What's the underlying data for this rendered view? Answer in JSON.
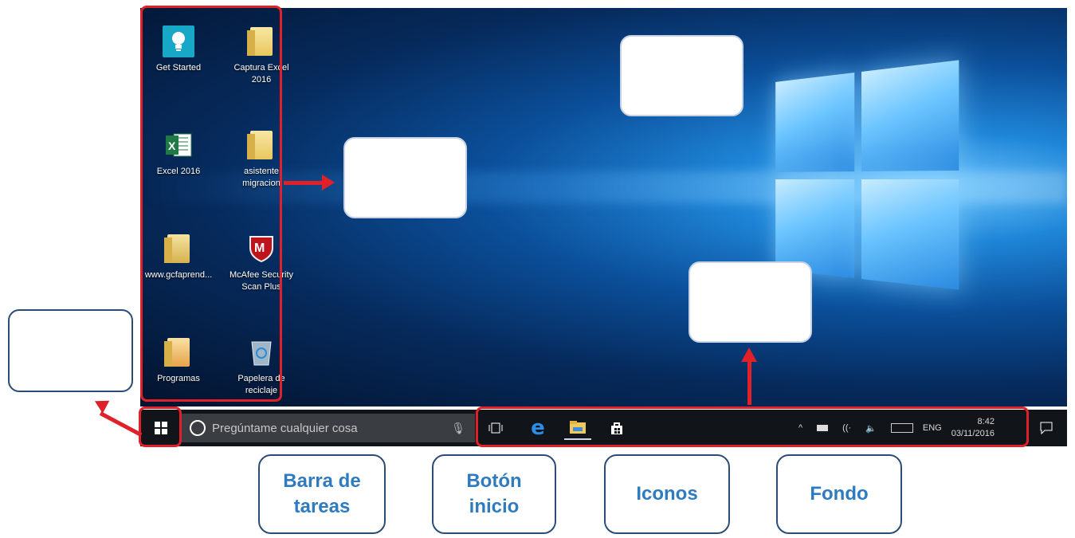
{
  "desktop": {
    "icons": [
      {
        "label": "Get Started",
        "icon": "get-started-icon"
      },
      {
        "label": "Captura Excel\n2016",
        "icon": "folder-icon"
      },
      {
        "label": "Excel 2016",
        "icon": "excel-icon"
      },
      {
        "label": "asistente\nmigracion",
        "icon": "folder-icon"
      },
      {
        "label": "www.gcfaprend...",
        "icon": "folder-icon"
      },
      {
        "label": "McAfee Security\nScan Plus",
        "icon": "mcafee-icon"
      },
      {
        "label": "Programas",
        "icon": "folder-icon"
      },
      {
        "label": "Papelera de\nreciclaje",
        "icon": "recycle-bin-icon"
      }
    ]
  },
  "taskbar": {
    "search_placeholder": "Pregúntame cualquier cosa",
    "tray": {
      "language": "ENG",
      "time": "8:42",
      "date": "03/11/2016"
    }
  },
  "cards": [
    {
      "text": "Barra de\ntareas"
    },
    {
      "text": "Botón\ninicio"
    },
    {
      "text": "Iconos"
    },
    {
      "text": "Fondo"
    }
  ],
  "colors": {
    "annotation": "#e1212a",
    "card_text": "#2f7bbf",
    "card_border": "#2c4c78",
    "taskbar": "#111418"
  }
}
